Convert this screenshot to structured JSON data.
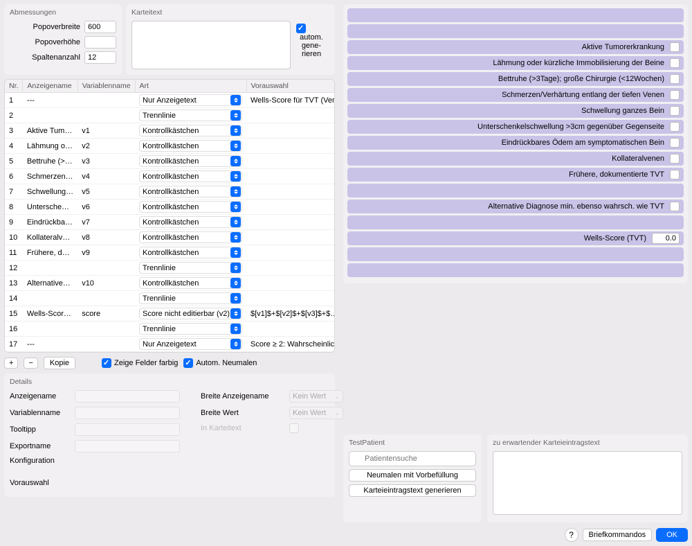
{
  "abmessungen": {
    "title": "Abmessungen",
    "popoverbreite_label": "Popoverbreite",
    "popoverbreite": "600",
    "popoverhoehe_label": "Popoverhöhe",
    "popoverhoehe": "",
    "spaltenanzahl_label": "Spaltenanzahl",
    "spaltenanzahl": "12"
  },
  "karteitext": {
    "title": "Karteitext",
    "autogen_label": "autom. gene-rieren"
  },
  "table": {
    "headers": {
      "nr": "Nr.",
      "anzeigename": "Anzeigename",
      "variablenname": "Variablenname",
      "art": "Art",
      "vorauswahl": "Vorauswahl"
    },
    "rows": [
      {
        "nr": "1",
        "anz": "---",
        "var": "",
        "art": "Nur Anzeigetext",
        "vor": "Wells-Score für TVT (Ven…"
      },
      {
        "nr": "2",
        "anz": "",
        "var": "",
        "art": "Trennlinie",
        "vor": ""
      },
      {
        "nr": "3",
        "anz": "Aktive Tum…",
        "var": "v1",
        "art": "Kontrollkästchen",
        "vor": ""
      },
      {
        "nr": "4",
        "anz": "Lähmung o…",
        "var": "v2",
        "art": "Kontrollkästchen",
        "vor": ""
      },
      {
        "nr": "5",
        "anz": "Bettruhe (>…",
        "var": "v3",
        "art": "Kontrollkästchen",
        "vor": ""
      },
      {
        "nr": "6",
        "anz": "Schmerzen…",
        "var": "v4",
        "art": "Kontrollkästchen",
        "vor": ""
      },
      {
        "nr": "7",
        "anz": "Schwellung…",
        "var": "v5",
        "art": "Kontrollkästchen",
        "vor": ""
      },
      {
        "nr": "8",
        "anz": "Untersche…",
        "var": "v6",
        "art": "Kontrollkästchen",
        "vor": ""
      },
      {
        "nr": "9",
        "anz": "Eindrückba…",
        "var": "v7",
        "art": "Kontrollkästchen",
        "vor": ""
      },
      {
        "nr": "10",
        "anz": "Kollateralv…",
        "var": "v8",
        "art": "Kontrollkästchen",
        "vor": ""
      },
      {
        "nr": "11",
        "anz": "Frühere, d…",
        "var": "v9",
        "art": "Kontrollkästchen",
        "vor": ""
      },
      {
        "nr": "12",
        "anz": "",
        "var": "",
        "art": "Trennlinie",
        "vor": ""
      },
      {
        "nr": "13",
        "anz": "Alternative…",
        "var": "v10",
        "art": "Kontrollkästchen",
        "vor": ""
      },
      {
        "nr": "14",
        "anz": "",
        "var": "",
        "art": "Trennlinie",
        "vor": ""
      },
      {
        "nr": "15",
        "anz": "Wells-Scor…",
        "var": "score",
        "art": "Score nicht editierbar (v2)",
        "vor": "$[v1]$+$[v2]$+$[v3]$+$…"
      },
      {
        "nr": "16",
        "anz": "",
        "var": "",
        "art": "Trennlinie",
        "vor": ""
      },
      {
        "nr": "17",
        "anz": "---",
        "var": "",
        "art": "Nur Anzeigetext",
        "vor": "Score ≥ 2: Wahrscheinlic…"
      }
    ]
  },
  "toolbar": {
    "add": "+",
    "remove": "−",
    "kopie": "Kopie",
    "zeige_farbig": "Zeige Felder farbig",
    "autom_neumalen": "Autom. Neumalen"
  },
  "details": {
    "title": "Details",
    "anzeigename": "Anzeigename",
    "variablenname": "Variablenname",
    "tooltipp": "Tooltipp",
    "exportname": "Exportname",
    "konfiguration": "Konfiguration",
    "vorauswahl": "Vorauswahl",
    "breite_anz": "Breite Anzeigename",
    "breite_wert": "Breite Wert",
    "in_karteitext": "In Karteitext",
    "kein_wert": "Kein Wert"
  },
  "preview": {
    "items": [
      "Aktive Tumorerkrankung",
      "Lähmung oder kürzliche Immobilisierung der Beine",
      "Bettruhe (>3Tage); große Chirurgie (<12Wochen)",
      "Schmerzen/Verhärtung entlang der tiefen Venen",
      "Schwellung ganzes Bein",
      "Unterschenkelschwellung >3cm gegenüber Gegenseite",
      "Eindrückbares Ödem am symptomatischen Bein",
      "Kollateralvenen",
      "Frühere, dokumentierte TVT"
    ],
    "alt": "Alternative Diagnose min. ebenso wahrsch. wie TVT",
    "score_label": "Wells-Score (TVT)",
    "score_value": "0.0"
  },
  "bottom": {
    "test_patient": "TestPatient",
    "expected": "zu erwartender Karteieintragstext",
    "search_placeholder": "Patientensuche",
    "neumalen": "Neumalen mit Vorbefüllung",
    "generieren": "Karteieintragstext generieren"
  },
  "footer": {
    "help": "?",
    "briefkommandos": "Briefkommandos",
    "ok": "OK"
  }
}
